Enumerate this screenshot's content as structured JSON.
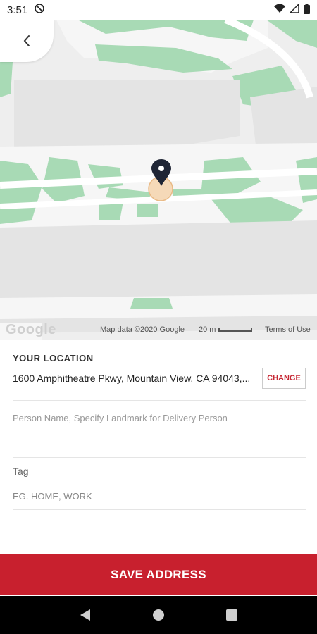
{
  "status_bar": {
    "time": "3:51"
  },
  "map": {
    "google_logo": "Google",
    "map_data": "Map data ©2020 Google",
    "scale_label": "20 m",
    "terms": "Terms of Use"
  },
  "location": {
    "title": "YOUR LOCATION",
    "address": "1600 Amphitheatre Pkwy, Mountain View, CA 94043,...",
    "change_label": "CHANGE"
  },
  "landmark": {
    "placeholder": "Person Name, Specify Landmark for Delivery Person"
  },
  "tag": {
    "label": "Tag",
    "placeholder": "EG. HOME, WORK"
  },
  "save_label": "SAVE ADDRESS",
  "colors": {
    "accent": "#c8202e",
    "map_green": "#a8dab5",
    "pin": "#1f2535",
    "pin_circle": "#f5d9b8"
  },
  "icons": {
    "back": "chevron-left-icon",
    "pin": "map-pin-icon"
  }
}
